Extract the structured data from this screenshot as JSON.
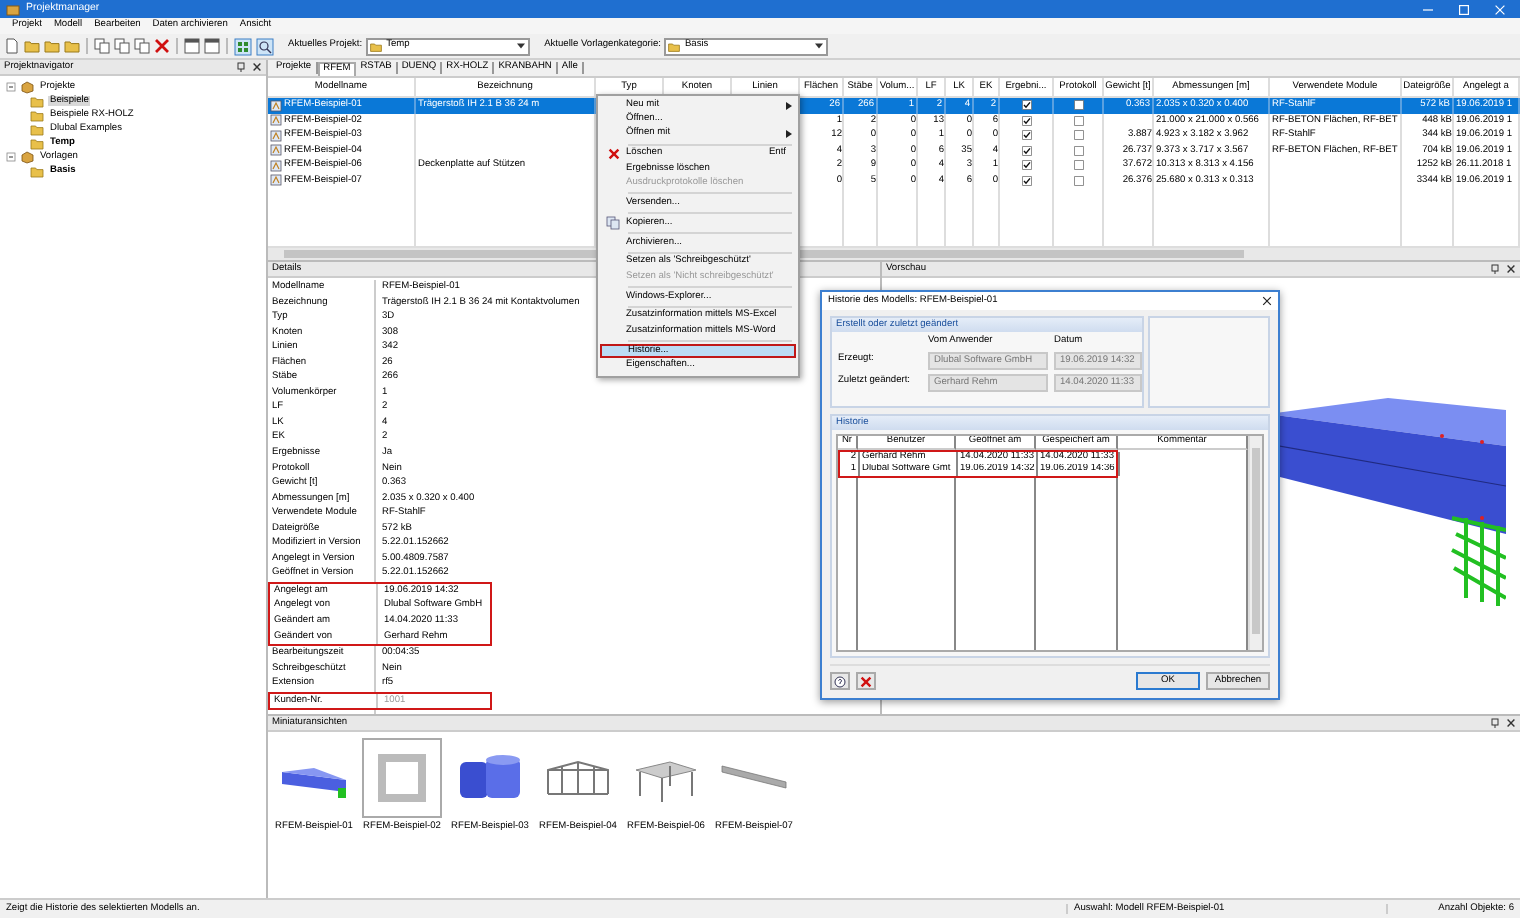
{
  "window": {
    "title": "Projektmanager"
  },
  "menu": [
    "Projekt",
    "Modell",
    "Bearbeiten",
    "Daten archivieren",
    "Ansicht"
  ],
  "toolbar": {
    "project_label": "Aktuelles Projekt:",
    "project": "Temp",
    "category_label": "Aktuelle Vorlagenkategorie:",
    "category": "Basis"
  },
  "navigator": {
    "title": "Projektnavigator",
    "tree": [
      {
        "label": "Projekte",
        "expanded": true,
        "children": [
          {
            "label": "Beispiele",
            "selected": true,
            "current": false
          },
          {
            "label": "Beispiele RX-HOLZ",
            "selected": false,
            "current": false
          },
          {
            "label": "Dlubal Examples",
            "selected": false,
            "current": false
          },
          {
            "label": "Temp",
            "selected": false,
            "current": true
          }
        ]
      },
      {
        "label": "Vorlagen",
        "expanded": true,
        "children": [
          {
            "label": "Basis",
            "selected": false,
            "current": true
          }
        ]
      }
    ]
  },
  "tabs": [
    {
      "label": "Projekte",
      "selected": false
    },
    {
      "label": "RFEM",
      "selected": true
    },
    {
      "label": "RSTAB",
      "selected": false
    },
    {
      "label": "DUENQ",
      "selected": false
    },
    {
      "label": "RX-HOLZ",
      "selected": false
    },
    {
      "label": "KRANBAHN",
      "selected": false
    },
    {
      "label": "Alle",
      "selected": false
    }
  ],
  "table": {
    "columns": [
      {
        "label": "Modellname",
        "kind": "text"
      },
      {
        "label": "Bezeichnung",
        "kind": "text"
      },
      {
        "label": "Typ",
        "kind": "text"
      },
      {
        "label": "Knoten",
        "kind": "text"
      },
      {
        "label": "Linien",
        "kind": "text"
      },
      {
        "label": "Flächen",
        "kind": "text"
      },
      {
        "label": "Stäbe",
        "kind": "text"
      },
      {
        "label": "Volum...",
        "kind": "text"
      },
      {
        "label": "LF",
        "kind": "text"
      },
      {
        "label": "LK",
        "kind": "text"
      },
      {
        "label": "EK",
        "kind": "text"
      },
      {
        "label": "Ergebni...",
        "kind": "check"
      },
      {
        "label": "Protokoll",
        "kind": "check"
      },
      {
        "label": "Gewicht [t]",
        "kind": "text"
      },
      {
        "label": "Abmessungen [m]",
        "kind": "text"
      },
      {
        "label": "Verwendete Module",
        "kind": "text"
      },
      {
        "label": "Dateigröße",
        "kind": "text"
      },
      {
        "label": "Angelegt a",
        "kind": "text"
      }
    ],
    "rows": [
      {
        "selected": true,
        "cells": [
          "RFEM-Beispiel-01",
          "Trägerstoß IH 2.1 B 36 24 m",
          null,
          null,
          null,
          "26",
          "266",
          "1",
          "2",
          "4",
          "2",
          true,
          false,
          "0.363",
          "2.035 x 0.320 x 0.400",
          "RF-StahlF",
          "572 kB",
          "19.06.2019 1"
        ]
      },
      {
        "selected": false,
        "cells": [
          "RFEM-Beispiel-02",
          null,
          null,
          null,
          null,
          "1",
          "2",
          "0",
          "13",
          "0",
          "6",
          true,
          false,
          null,
          "21.000 x 21.000 x 0.566",
          "RF-BETON Flächen, RF-BET",
          "448 kB",
          "19.06.2019 1"
        ]
      },
      {
        "selected": false,
        "cells": [
          "RFEM-Beispiel-03",
          null,
          null,
          null,
          null,
          "12",
          "0",
          "0",
          "1",
          "0",
          "0",
          true,
          false,
          "3.887",
          "4.923 x 3.182 x 3.962",
          "RF-StahlF",
          "344 kB",
          "19.06.2019 1"
        ]
      },
      {
        "selected": false,
        "cells": [
          "RFEM-Beispiel-04",
          null,
          null,
          null,
          null,
          "4",
          "3",
          "0",
          "6",
          "35",
          "4",
          true,
          false,
          "26.737",
          "9.373 x 3.717 x 3.567",
          "RF-BETON Flächen, RF-BET",
          "704 kB",
          "19.06.2019 1"
        ]
      },
      {
        "selected": false,
        "cells": [
          "RFEM-Beispiel-06",
          "Deckenplatte auf Stützen",
          null,
          null,
          null,
          "2",
          "9",
          "0",
          "4",
          "3",
          "1",
          true,
          false,
          "37.672",
          "10.313 x 8.313 x 4.156",
          null,
          "1252 kB",
          "26.11.2018 1"
        ]
      },
      {
        "selected": false,
        "cells": [
          "RFEM-Beispiel-07",
          null,
          null,
          null,
          null,
          "0",
          "5",
          "0",
          "4",
          "6",
          "0",
          true,
          false,
          "26.376",
          "25.680 x 0.313 x 0.313",
          null,
          "3344 kB",
          "19.06.2019 1"
        ]
      }
    ]
  },
  "details": {
    "title": "Details",
    "items": [
      {
        "key": "Modellname",
        "value": "RFEM-Beispiel-01",
        "highlighted": false,
        "disabled": false
      },
      {
        "key": "Bezeichnung",
        "value": "Trägerstoß IH 2.1 B 36 24 mit Kontaktvolumen",
        "highlighted": false,
        "disabled": false
      },
      {
        "key": "Typ",
        "value": "3D",
        "highlighted": false,
        "disabled": false
      },
      {
        "key": "Knoten",
        "value": "308",
        "highlighted": false,
        "disabled": false
      },
      {
        "key": "Linien",
        "value": "342",
        "highlighted": false,
        "disabled": false
      },
      {
        "key": "Flächen",
        "value": "26",
        "highlighted": false,
        "disabled": false
      },
      {
        "key": "Stäbe",
        "value": "266",
        "highlighted": false,
        "disabled": false
      },
      {
        "key": "Volumenkörper",
        "value": "1",
        "highlighted": false,
        "disabled": false
      },
      {
        "key": "LF",
        "value": "2",
        "highlighted": false,
        "disabled": false
      },
      {
        "key": "LK",
        "value": "4",
        "highlighted": false,
        "disabled": false
      },
      {
        "key": "EK",
        "value": "2",
        "highlighted": false,
        "disabled": false
      },
      {
        "key": "Ergebnisse",
        "value": "Ja",
        "highlighted": false,
        "disabled": false
      },
      {
        "key": "Protokoll",
        "value": "Nein",
        "highlighted": false,
        "disabled": false
      },
      {
        "key": "Gewicht [t]",
        "value": "0.363",
        "highlighted": false,
        "disabled": false
      },
      {
        "key": "Abmessungen [m]",
        "value": "2.035 x 0.320 x 0.400",
        "highlighted": false,
        "disabled": false
      },
      {
        "key": "Verwendete Module",
        "value": "RF-StahlF",
        "highlighted": false,
        "disabled": false
      },
      {
        "key": "Dateigröße",
        "value": "572 kB",
        "highlighted": false,
        "disabled": false
      },
      {
        "key": "Modifiziert in Version",
        "value": "5.22.01.152662",
        "highlighted": false,
        "disabled": false
      },
      {
        "key": "Angelegt in Version",
        "value": "5.00.4809.7587",
        "highlighted": false,
        "disabled": false
      },
      {
        "key": "Geöffnet in Version",
        "value": "5.22.01.152662",
        "highlighted": false,
        "disabled": false
      },
      {
        "key": "Angelegt am",
        "value": "19.06.2019 14:32",
        "highlighted": true,
        "disabled": false
      },
      {
        "key": "Angelegt von",
        "value": "Dlubal Software GmbH",
        "highlighted": true,
        "disabled": false
      },
      {
        "key": "Geändert am",
        "value": "14.04.2020 11:33",
        "highlighted": true,
        "disabled": false
      },
      {
        "key": "Geändert von",
        "value": "Gerhard Rehm",
        "highlighted": true,
        "disabled": false
      },
      {
        "key": "Bearbeitungszeit",
        "value": "00:04:35",
        "highlighted": false,
        "disabled": false
      },
      {
        "key": "Schreibgeschützt",
        "value": "Nein",
        "highlighted": false,
        "disabled": false
      },
      {
        "key": "Extension",
        "value": "rf5",
        "highlighted": false,
        "disabled": false
      },
      {
        "key": "Kunden-Nr.",
        "value": "1001",
        "highlighted": true,
        "disabled": true
      }
    ]
  },
  "preview": {
    "title": "Vorschau"
  },
  "context_menu": [
    {
      "kind": "item",
      "label": "Neu mit",
      "submenu": true,
      "disabled": false,
      "selected": false,
      "highlighted": false
    },
    {
      "kind": "item",
      "label": "Öffnen...",
      "submenu": false,
      "disabled": false,
      "selected": false,
      "highlighted": false
    },
    {
      "kind": "item",
      "label": "Öffnen mit",
      "submenu": true,
      "disabled": false,
      "selected": false,
      "highlighted": false
    },
    {
      "kind": "separator"
    },
    {
      "kind": "delete",
      "label": "Löschen",
      "shortcut": "Entf",
      "submenu": false,
      "disabled": false,
      "selected": false,
      "highlighted": false
    },
    {
      "kind": "item",
      "label": "Ergebnisse löschen",
      "submenu": false,
      "disabled": false,
      "selected": false,
      "highlighted": false
    },
    {
      "kind": "item",
      "label": "Ausdruckprotokolle löschen",
      "submenu": false,
      "disabled": true,
      "selected": false,
      "highlighted": false
    },
    {
      "kind": "separator"
    },
    {
      "kind": "item",
      "label": "Versenden...",
      "submenu": false,
      "disabled": false,
      "selected": false,
      "highlighted": false
    },
    {
      "kind": "separator"
    },
    {
      "kind": "copy",
      "label": "Kopieren...",
      "submenu": false,
      "disabled": false,
      "selected": false,
      "highlighted": false
    },
    {
      "kind": "separator"
    },
    {
      "kind": "item",
      "label": "Archivieren...",
      "submenu": false,
      "disabled": false,
      "selected": false,
      "highlighted": false
    },
    {
      "kind": "separator"
    },
    {
      "kind": "item",
      "label": "Setzen als 'Schreibgeschützt'",
      "submenu": false,
      "disabled": false,
      "selected": false,
      "highlighted": false
    },
    {
      "kind": "item",
      "label": "Setzen als 'Nicht schreibgeschützt'",
      "submenu": false,
      "disabled": true,
      "selected": false,
      "highlighted": false
    },
    {
      "kind": "separator"
    },
    {
      "kind": "item",
      "label": "Windows-Explorer...",
      "submenu": false,
      "disabled": false,
      "selected": false,
      "highlighted": false
    },
    {
      "kind": "separator"
    },
    {
      "kind": "item",
      "label": "Zusatzinformation mittels MS-Excel",
      "submenu": false,
      "disabled": false,
      "selected": false,
      "highlighted": false
    },
    {
      "kind": "item",
      "label": "Zusatzinformation mittels MS-Word",
      "submenu": false,
      "disabled": false,
      "selected": false,
      "highlighted": false
    },
    {
      "kind": "separator"
    },
    {
      "kind": "item",
      "label": "Historie...",
      "submenu": false,
      "disabled": false,
      "selected": true,
      "highlighted": true
    },
    {
      "kind": "item",
      "label": "Eigenschaften...",
      "submenu": false,
      "disabled": false,
      "selected": false,
      "highlighted": false
    }
  ],
  "dialog": {
    "title": "Historie des Modells: RFEM-Beispiel-01",
    "info": {
      "title": "Erstellt oder zuletzt geändert",
      "headers": [
        "Vom Anwender",
        "Datum"
      ],
      "rows": [
        {
          "label": "Erzeugt:",
          "user": "Dlubal Software GmbH",
          "date": "19.06.2019 14:32"
        },
        {
          "label": "Zuletzt geändert:",
          "user": "Gerhard Rehm",
          "date": "14.04.2020 11:33"
        }
      ]
    },
    "history": {
      "title": "Historie",
      "columns": [
        "Nr",
        "Benutzer",
        "Geöffnet am",
        "Gespeichert am",
        "Kommentar"
      ],
      "rows": [
        {
          "cells": [
            "2",
            "Gerhard Rehm",
            "14.04.2020 11:33",
            "14.04.2020 11:33"
          ],
          "highlighted": true
        },
        {
          "cells": [
            "1",
            "Dlubal Software Gmt",
            "19.06.2019 14:32",
            "19.06.2019 14:36"
          ],
          "highlighted": true
        }
      ]
    },
    "buttons": [
      "OK",
      "Abbrechen"
    ]
  },
  "miniatures": {
    "title": "Miniaturansichten",
    "items": [
      {
        "label": "RFEM-Beispiel-01",
        "kind": "beam",
        "selected": false
      },
      {
        "label": "RFEM-Beispiel-02",
        "kind": "plate",
        "selected": true
      },
      {
        "label": "RFEM-Beispiel-03",
        "kind": "tank",
        "selected": false
      },
      {
        "label": "RFEM-Beispiel-04",
        "kind": "hall",
        "selected": false
      },
      {
        "label": "RFEM-Beispiel-06",
        "kind": "slab",
        "selected": false
      },
      {
        "label": "RFEM-Beispiel-07",
        "kind": "bar",
        "selected": false
      }
    ]
  },
  "status_bar": {
    "hint": "Zeigt die Historie des selektierten Modells an.",
    "selection": "Auswahl: Modell RFEM-Beispiel-01",
    "count": "Anzahl Objekte: 6"
  }
}
